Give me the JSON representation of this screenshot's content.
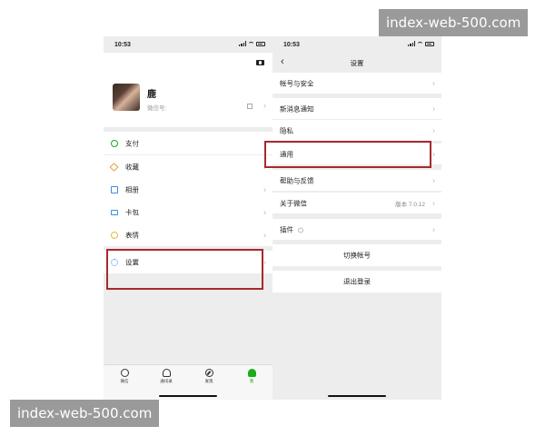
{
  "watermark": "index-web-500.com",
  "left": {
    "time": "10:53",
    "profile": {
      "name": "鹿",
      "wechat_id_label": "微信号:"
    },
    "menu": [
      {
        "label": "支付",
        "icon": "wallet-icon"
      },
      {
        "label": "收藏",
        "icon": "favorites-icon"
      },
      {
        "label": "相册",
        "icon": "album-icon"
      },
      {
        "label": "卡包",
        "icon": "card-icon"
      },
      {
        "label": "表情",
        "icon": "sticker-icon"
      },
      {
        "label": "设置",
        "icon": "gear-icon"
      }
    ],
    "tabs": [
      {
        "label": "微信",
        "icon": "chat-icon"
      },
      {
        "label": "通讯录",
        "icon": "contacts-icon"
      },
      {
        "label": "发现",
        "icon": "discover-icon"
      },
      {
        "label": "我",
        "icon": "me-icon",
        "active": true
      }
    ]
  },
  "right": {
    "time": "10:53",
    "title": "设置",
    "items": [
      {
        "label": "帐号与安全"
      },
      {
        "label": "新消息通知"
      },
      {
        "label": "隐私"
      },
      {
        "label": "通用"
      },
      {
        "label": "帮助与反馈"
      },
      {
        "label": "关于微信",
        "value": "版本 7.0.12"
      },
      {
        "label": "插件"
      }
    ],
    "switch_account": "切换帐号",
    "logout": "退出登录"
  },
  "colors": {
    "highlight": "#a8282f",
    "accent_green": "#1aad19",
    "background": "#ededed"
  }
}
